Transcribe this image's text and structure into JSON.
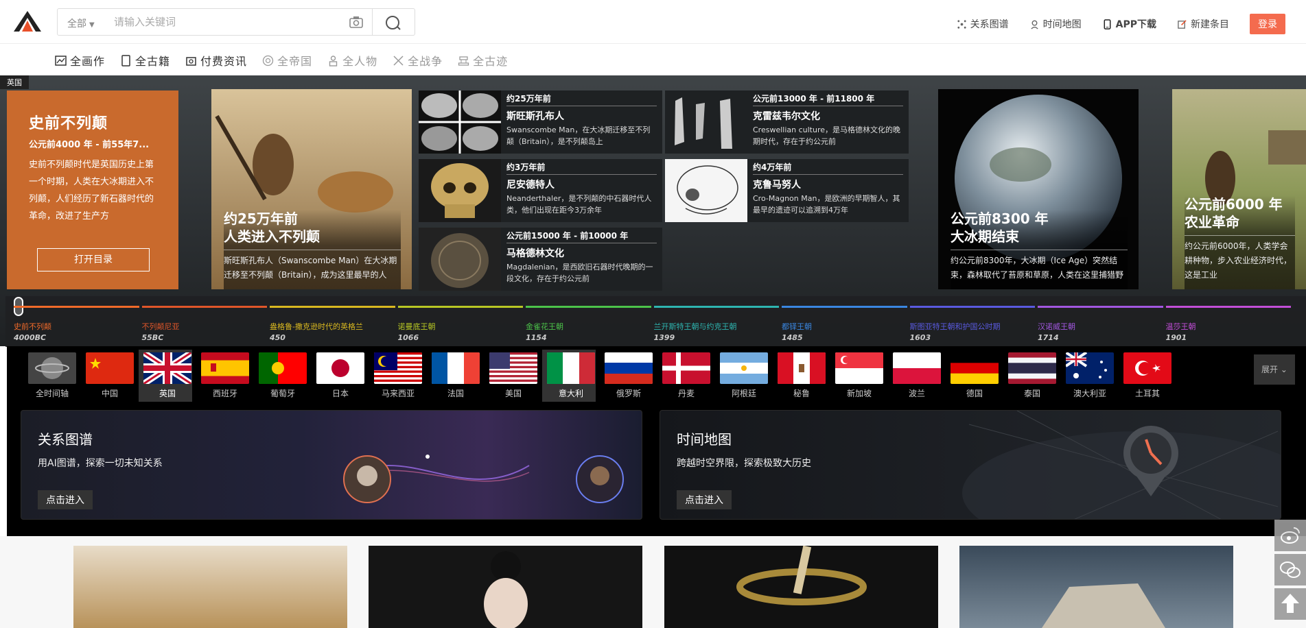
{
  "header": {
    "search": {
      "scope": "全部",
      "placeholder": "请输入关键词"
    },
    "links": [
      {
        "label": "关系图谱",
        "icon": "graph-icon"
      },
      {
        "label": "时间地图",
        "icon": "location-icon"
      },
      {
        "label": "APP下载",
        "icon": "phone-icon"
      },
      {
        "label": "新建条目",
        "icon": "edit-icon"
      }
    ],
    "login": "登录"
  },
  "nav": [
    {
      "label": "全画作",
      "icon": "painting-icon",
      "dim": false
    },
    {
      "label": "全古籍",
      "icon": "book-icon",
      "dim": false
    },
    {
      "label": "付费资讯",
      "icon": "paid-icon",
      "dim": false
    },
    {
      "label": "全帝国",
      "icon": "empire-icon",
      "dim": true
    },
    {
      "label": "全人物",
      "icon": "person-icon",
      "dim": true
    },
    {
      "label": "全战争",
      "icon": "sword-icon",
      "dim": true
    },
    {
      "label": "全古迹",
      "icon": "monument-icon",
      "dim": true
    }
  ],
  "hero": {
    "country_tag": "英国",
    "intro": {
      "title": "史前不列颠",
      "date": "公元前4000 年 - 前55年7...",
      "desc": "史前不列颠时代是英国历史上第一个时期，人类在大冰期进入不列颠，人们经历了新石器时代的革命，改进了生产方",
      "button": "打开目录"
    },
    "big_cards": [
      {
        "t1": "约25万年前",
        "t2": "人类进入不列颠",
        "desc": "斯旺斯孔布人（Swanscombe Man）在大冰期迁移至不列颠（Britain），成为这里最早的人"
      },
      {
        "t1": "公元前8300 年",
        "t2": "大冰期结束",
        "desc": "约公元前8300年，大冰期（Ice Age）突然结束，森林取代了苔原和草原，人类在这里捕猎野"
      },
      {
        "t1": "公元前6000 年",
        "t2": "农业革命",
        "desc": "约公元前6000年，人类学会耕种物，步入农业经济时代，这是工业"
      }
    ],
    "small_cards": [
      {
        "date": "约25万年前",
        "name": "斯旺斯孔布人",
        "desc": "Swanscombe Man，在大冰期迁移至不列颠（Britain），是不列颠岛上"
      },
      {
        "date": "约3万年前",
        "name": "尼安德特人",
        "desc": "Neanderthaler，是不列颠的中石器时代人类，他们出现在距今3万余年"
      },
      {
        "date": "公元前15000 年 - 前10000 年",
        "name": "马格德林文化",
        "desc": "Magdalenian，是西欧旧石器时代晚期的一段文化，存在于约公元前"
      },
      {
        "date": "公元前13000 年 - 前11800 年",
        "name": "克雷兹韦尔文化",
        "desc": "Creswellian culture，是马格德林文化的晚期时代，存在于约公元前"
      },
      {
        "date": "约4万年前",
        "name": "克鲁马努人",
        "desc": "Cro-Magnon Man，是欧洲的早期智人，其最早的遗迹可以追溯到4万年"
      }
    ]
  },
  "timeline": [
    {
      "label": "史前不列颠",
      "year": "4000BC",
      "color": "#f06a2a"
    },
    {
      "label": "不列颠尼亚",
      "year": "55BC",
      "color": "#e0562a"
    },
    {
      "label": "盎格鲁-撒克逊时代的英格兰",
      "year": "450",
      "color": "#d9b820"
    },
    {
      "label": "诺曼底王朝",
      "year": "1066",
      "color": "#b8c724"
    },
    {
      "label": "金雀花王朝",
      "year": "1154",
      "color": "#4cc34a"
    },
    {
      "label": "兰开斯特王朝与约克王朝",
      "year": "1399",
      "color": "#2eb5b0"
    },
    {
      "label": "都铎王朝",
      "year": "1485",
      "color": "#3a86e0"
    },
    {
      "label": "斯图亚特王朝和护国公时期",
      "year": "1603",
      "color": "#5a5ae0"
    },
    {
      "label": "汉诺威王朝",
      "year": "1714",
      "color": "#a257e0"
    },
    {
      "label": "温莎王朝",
      "year": "1901",
      "color": "#c24ed8"
    }
  ],
  "countries": [
    {
      "name": "全时间轴",
      "sel": false
    },
    {
      "name": "中国",
      "sel": false
    },
    {
      "name": "英国",
      "sel": true
    },
    {
      "name": "西班牙",
      "sel": false
    },
    {
      "name": "葡萄牙",
      "sel": false
    },
    {
      "name": "日本",
      "sel": false
    },
    {
      "name": "马来西亚",
      "sel": false
    },
    {
      "name": "法国",
      "sel": false
    },
    {
      "name": "美国",
      "sel": false
    },
    {
      "name": "意大利",
      "sel": true
    },
    {
      "name": "俄罗斯",
      "sel": false
    },
    {
      "name": "丹麦",
      "sel": false
    },
    {
      "name": "阿根廷",
      "sel": false
    },
    {
      "name": "秘鲁",
      "sel": false
    },
    {
      "name": "新加坡",
      "sel": false
    },
    {
      "name": "波兰",
      "sel": false
    },
    {
      "name": "德国",
      "sel": false
    },
    {
      "name": "泰国",
      "sel": false
    },
    {
      "name": "澳大利亚",
      "sel": false
    },
    {
      "name": "土耳其",
      "sel": false
    }
  ],
  "expand": "展开",
  "features": [
    {
      "title": "关系图谱",
      "desc": "用AI图谱，探索一切未知关系",
      "button": "点击进入"
    },
    {
      "title": "时间地图",
      "desc": "跨越时空界限，探索极致大历史",
      "button": "点击进入"
    }
  ],
  "side_tools": [
    {
      "icon": "weibo-icon"
    },
    {
      "icon": "wechat-icon"
    },
    {
      "icon": "back-to-top-icon"
    }
  ]
}
